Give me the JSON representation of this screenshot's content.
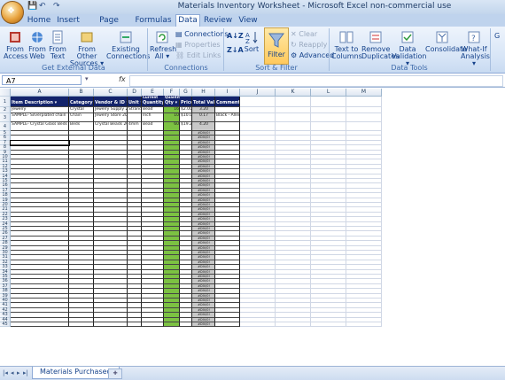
{
  "window": {
    "title": "Materials Inventory Worksheet - Microsoft Excel non-commercial use",
    "office_button": "office-logo-icon",
    "qat_icons": [
      "save-icon",
      "undo-icon",
      "redo-icon"
    ]
  },
  "tabs": [
    "Home",
    "Insert",
    "Page Layout",
    "Formulas",
    "Data",
    "Review",
    "View"
  ],
  "active_tab": "Data",
  "ribbon": {
    "get_external_data": {
      "label": "Get External Data",
      "buttons": [
        {
          "line1": "From",
          "line2": "Access",
          "icon": "access-icon"
        },
        {
          "line1": "From",
          "line2": "Web",
          "icon": "web-icon"
        },
        {
          "line1": "From",
          "line2": "Text",
          "icon": "text-file-icon"
        },
        {
          "line1": "From Other",
          "line2": "Sources ▾",
          "icon": "other-sources-icon"
        },
        {
          "line1": "Existing",
          "line2": "Connections",
          "icon": "existing-connections-icon"
        }
      ]
    },
    "connections": {
      "label": "Connections",
      "refresh": {
        "line1": "Refresh",
        "line2": "All ▾"
      },
      "small": [
        "Connections",
        "Properties",
        "Edit Links"
      ]
    },
    "sort_filter": {
      "label": "Sort & Filter",
      "sort_az": "A↓Z",
      "sort_za": "Z↓A",
      "sort": "Sort",
      "filter": "Filter",
      "small": [
        "Clear",
        "Reapply",
        "Advanced"
      ]
    },
    "data_tools": {
      "label": "Data Tools",
      "buttons": [
        {
          "line1": "Text to",
          "line2": "Columns"
        },
        {
          "line1": "Remove",
          "line2": "Duplicates"
        },
        {
          "line1": "Data",
          "line2": "Validation ▾"
        },
        {
          "line1": "Consolidate",
          "line2": ""
        },
        {
          "line1": "What-If",
          "line2": "Analysis ▾"
        }
      ]
    },
    "outline_partial": "G"
  },
  "formula_bar": {
    "name_box": "A7",
    "fx": "fx",
    "value": ""
  },
  "columns": [
    "A",
    "B",
    "C",
    "D",
    "E",
    "F",
    "G",
    "H",
    "I",
    "J",
    "K",
    "L",
    "M"
  ],
  "header_labels": {
    "A": "Item Description",
    "B": "Category",
    "C": "Vendor & ID",
    "D": "Unit",
    "E": "Quantity Unit",
    "F": "Qty",
    "G": "Price",
    "H": "Total Value",
    "I": "Comments",
    "E_top": "Current",
    "F_top": "Quantity"
  },
  "rows": [
    {
      "n": "2",
      "A": "Jewelry",
      "B": "Crystal",
      "C": "Jewelry Supply 201",
      "D": "Strand",
      "E": "Bead",
      "F": "16",
      "G": "$2.00",
      "H": "3.20",
      "I": ""
    },
    {
      "n": "3",
      "A": "SAMPLE- Silverplated chain",
      "B": "Chain",
      "C": "Jewelry Store 2061",
      "D": "",
      "E": "Inch",
      "F": "10",
      "G": "$10.00",
      "H": "0.17",
      "I": "Black - Allenhor"
    },
    {
      "n": "4",
      "A": "SAMPLE- Crystal Glass Beds",
      "B": "Beds",
      "C": "Crystal Beads 2016",
      "D": "4mm",
      "E": "Bead",
      "F": "60",
      "G": "$19.20",
      "H": "4.20",
      "I": ""
    }
  ],
  "empty_row_value": "#DIV/0!",
  "sheet_tab": "Materials Purchased",
  "colors": {
    "header_fill": "#13236b",
    "qty_fill": "#7cc242",
    "total_fill": "#c8c8c8",
    "ribbon": "#d6e4f6"
  }
}
